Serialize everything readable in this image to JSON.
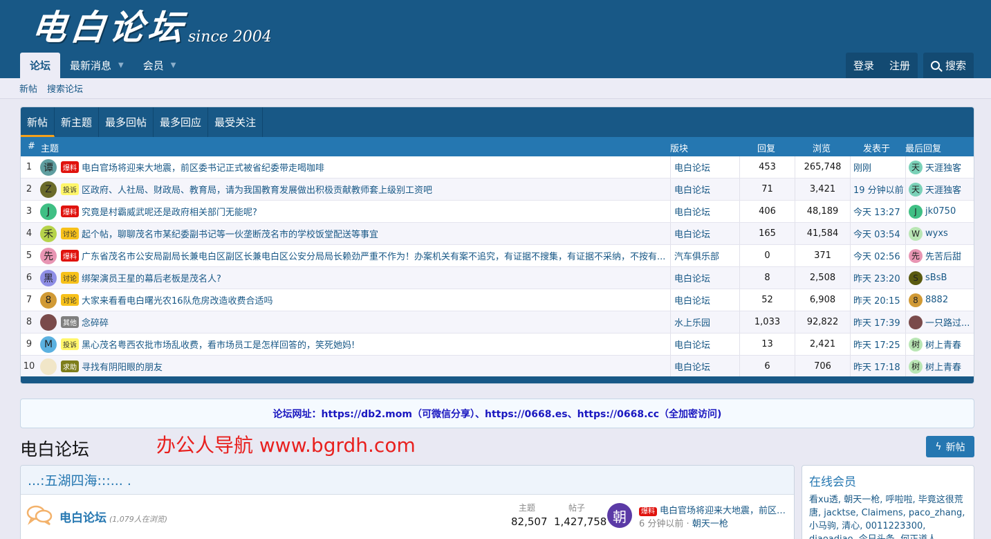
{
  "header": {
    "logo_text": "电白论坛",
    "logo_since": "since 2004"
  },
  "nav": {
    "tabs": [
      {
        "label": "论坛",
        "active": true
      },
      {
        "label": "最新消息",
        "dropdown": true
      },
      {
        "label": "会员",
        "dropdown": true
      }
    ],
    "login": "登录",
    "register": "注册",
    "search": "搜索"
  },
  "subnav": {
    "items": [
      "新帖",
      "搜索论坛"
    ]
  },
  "new_posts": {
    "tabs": [
      "新帖",
      "新主题",
      "最多回帖",
      "最多回应",
      "最受关注"
    ],
    "columns": {
      "num": "#",
      "topic": "主题",
      "forum": "版块",
      "replies": "回复",
      "views": "浏览",
      "posted": "发表于",
      "last": "最后回复"
    },
    "rows": [
      {
        "num": "1",
        "avatar": "谭",
        "avatar_color": "#5f9ea0",
        "prefix": "爆料",
        "prefix_bg": "#e0120d",
        "prefix_fg": "#ffffff",
        "title": "电白官场将迎来大地震，前区委书记正式被省纪委带走喝咖啡",
        "forum": "电白论坛",
        "replies": "453",
        "views": "265,748",
        "time": "刚刚",
        "last_avatar": "天",
        "last_color": "#7ad1b8",
        "last_user": "天涯独客"
      },
      {
        "num": "2",
        "avatar": "Z",
        "avatar_color": "#6b6b2a",
        "prefix": "投诉",
        "prefix_bg": "#fff66a",
        "prefix_fg": "#333333",
        "title": "区政府、人社局、财政局、教育局，请为我国教育发展做出积极贡献教师套上级别工资吧",
        "forum": "电白论坛",
        "replies": "71",
        "views": "3,421",
        "time": "19 分钟以前",
        "last_avatar": "天",
        "last_color": "#7ad1b8",
        "last_user": "天涯独客"
      },
      {
        "num": "3",
        "avatar": "J",
        "avatar_color": "#3fbf84",
        "prefix": "爆料",
        "prefix_bg": "#e0120d",
        "prefix_fg": "#ffffff",
        "title": "究竟是村霸威武呢还是政府相关部门无能呢?",
        "forum": "电白论坛",
        "replies": "406",
        "views": "48,189",
        "time": "今天 13:27",
        "last_avatar": "J",
        "last_color": "#3fbf84",
        "last_user": "jk0750"
      },
      {
        "num": "4",
        "avatar": "禾",
        "avatar_color": "#b6d34a",
        "prefix": "讨论",
        "prefix_bg": "#f7c11a",
        "prefix_fg": "#333333",
        "title": "起个帖，聊聊茂名市某纪委副书记等一伙垄断茂名市的学校饭堂配送等事宜",
        "forum": "电白论坛",
        "replies": "165",
        "views": "41,584",
        "time": "今天 03:54",
        "last_avatar": "W",
        "last_color": "#b9e6b4",
        "last_user": "wyxs"
      },
      {
        "num": "5",
        "avatar": "先",
        "avatar_color": "#e895b3",
        "prefix": "爆料",
        "prefix_bg": "#e0120d",
        "prefix_fg": "#ffffff",
        "title": "广东省茂名市公安局副局长兼电白区副区长兼电白区公安分局局长赖劲严重不作为！办案机关有案不追究，有证据不搜集，有证据不采纳，不按有...",
        "forum": "汽车俱乐部",
        "replies": "0",
        "views": "371",
        "time": "今天 02:56",
        "last_avatar": "先",
        "last_color": "#e895b3",
        "last_user": "先苦后甜"
      },
      {
        "num": "6",
        "avatar": "黑",
        "avatar_color": "#8e8ee6",
        "prefix": "讨论",
        "prefix_bg": "#f7c11a",
        "prefix_fg": "#333333",
        "title": "绑架演员王星的幕后老板是茂名人?",
        "forum": "电白论坛",
        "replies": "8",
        "views": "2,508",
        "time": "昨天 23:20",
        "last_avatar": "S",
        "last_color": "#5a5a0f",
        "last_user": "sBsB"
      },
      {
        "num": "7",
        "avatar": "8",
        "avatar_color": "#d19a35",
        "prefix": "讨论",
        "prefix_bg": "#f7c11a",
        "prefix_fg": "#333333",
        "title": "大家来看看电白曙光农16队危房改造收费合适吗",
        "forum": "电白论坛",
        "replies": "52",
        "views": "6,908",
        "time": "昨天 20:15",
        "last_avatar": "8",
        "last_color": "#d19a35",
        "last_user": "8882"
      },
      {
        "num": "8",
        "avatar": "",
        "avatar_color": "#7a4b4b",
        "prefix": "其他",
        "prefix_bg": "#7f7f7f",
        "prefix_fg": "#ffffff",
        "title": "念碎碎",
        "forum": "水上乐园",
        "replies": "1,033",
        "views": "92,822",
        "time": "昨天 17:39",
        "last_avatar": "",
        "last_color": "#7a4b4b",
        "last_user": "一只路过..."
      },
      {
        "num": "9",
        "avatar": "M",
        "avatar_color": "#5bb1e0",
        "prefix": "投诉",
        "prefix_bg": "#fff66a",
        "prefix_fg": "#333333",
        "title": "黑心茂名粤西农批市场乱收费，看市场员工是怎样回答的，笑死她妈!",
        "forum": "电白论坛",
        "replies": "13",
        "views": "2,421",
        "time": "昨天 17:25",
        "last_avatar": "树",
        "last_color": "#b9e6b4",
        "last_user": "树上青春"
      },
      {
        "num": "10",
        "avatar": "",
        "avatar_color": "#f1e6c8",
        "prefix": "求助",
        "prefix_bg": "#7d7d1a",
        "prefix_fg": "#ffffff",
        "title": "寻找有阴阳眼的朋友",
        "forum": "电白论坛",
        "replies": "6",
        "views": "706",
        "time": "昨天 17:18",
        "last_avatar": "树",
        "last_color": "#b9e6b4",
        "last_user": "树上青春"
      }
    ]
  },
  "notice": "论坛网址：https://db2.mom（可微信分享）、https://0668.es、https://0668.cc（全加密访问)",
  "section_title": "电白论坛",
  "promo": "办公人导航 www.bgrdh.com",
  "new_post_button": "新帖",
  "forum_category": {
    "title": "...:五湖四海:::... .",
    "forum": {
      "name": "电白论坛",
      "viewing": "(1,079人在浏览)",
      "topics_label": "主题",
      "topics": "82,507",
      "posts_label": "帖子",
      "posts": "1,427,758",
      "last_avatar": "朝",
      "last_prefix": "爆料",
      "last_title": "电白官场将迎来大地震，前区委书记正式被省纪委带走喝咖啡",
      "last_time": "6 分钟以前 · ",
      "last_user": "朝天一枪"
    }
  },
  "online": {
    "title": "在线会员",
    "members": "看xu透, 朝天一枪, 呼啦啦, 毕竟这很荒唐, jacktse, Claimens, paco_zhang, 小马驹, 清心, 0011223300, diaoadiao, 今日头条, 何正道人, Sanson, mmhwp, 安象"
  },
  "colors": {
    "brand": "#185886",
    "accent": "#2577b1",
    "tab_highlight": "#f6a11a",
    "promo": "#e8201e",
    "notice_text": "#1a17c0"
  }
}
